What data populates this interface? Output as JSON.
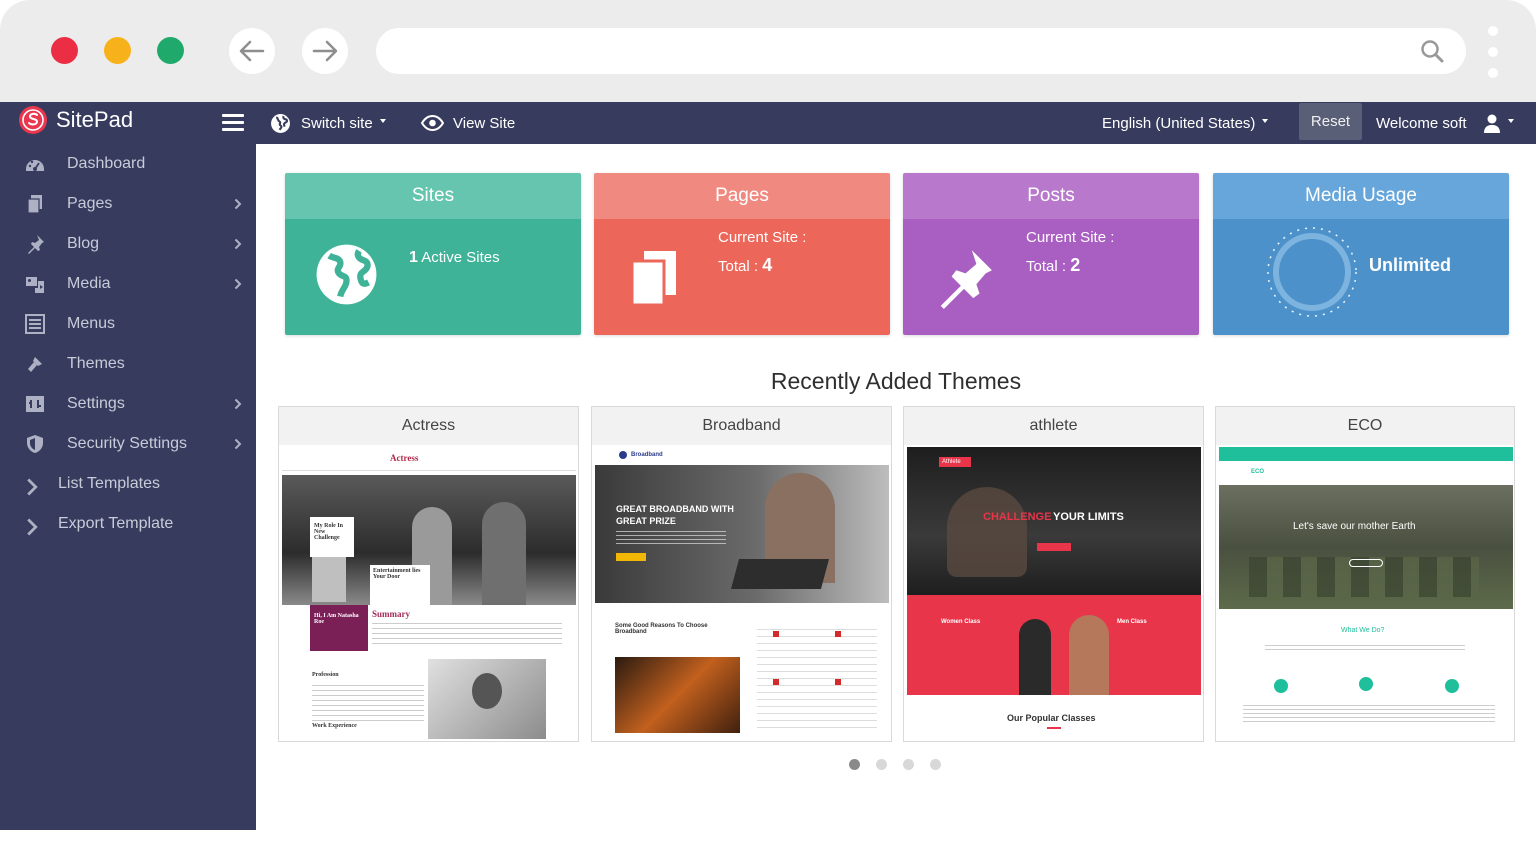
{
  "brand": {
    "name": "SitePad"
  },
  "topbar": {
    "switch_site": "Switch site",
    "view_site": "View Site",
    "language": "English (United States)",
    "reset": "Reset",
    "welcome": "Welcome soft"
  },
  "sidebar": {
    "items": [
      {
        "label": "Dashboard",
        "icon": "dashboard-icon",
        "has_children": false
      },
      {
        "label": "Pages",
        "icon": "pages-icon",
        "has_children": true
      },
      {
        "label": "Blog",
        "icon": "pin-icon",
        "has_children": true
      },
      {
        "label": "Media",
        "icon": "media-icon",
        "has_children": true
      },
      {
        "label": "Menus",
        "icon": "menu-list-icon",
        "has_children": false
      },
      {
        "label": "Themes",
        "icon": "brush-icon",
        "has_children": false
      },
      {
        "label": "Settings",
        "icon": "settings-icon",
        "has_children": true
      },
      {
        "label": "Security Settings",
        "icon": "shield-icon",
        "has_children": true
      },
      {
        "label": "List Templates",
        "icon": "chevron-right-icon",
        "has_children": false
      },
      {
        "label": "Export Template",
        "icon": "chevron-right-icon",
        "has_children": false
      }
    ]
  },
  "cards": {
    "sites": {
      "title": "Sites",
      "count": "1",
      "text": "Active Sites"
    },
    "pages": {
      "title": "Pages",
      "current_label": "Current Site :",
      "total_label": "Total :",
      "total": "4"
    },
    "posts": {
      "title": "Posts",
      "current_label": "Current Site :",
      "total_label": "Total :",
      "total": "2"
    },
    "media": {
      "title": "Media Usage",
      "text": "Unlimited"
    }
  },
  "themes_section": {
    "title": "Recently Added Themes",
    "themes": [
      {
        "name": "Actress"
      },
      {
        "name": "Broadband"
      },
      {
        "name": "athlete"
      },
      {
        "name": "ECO"
      }
    ]
  },
  "previews": {
    "actress": {
      "logo": "Actress",
      "hero_text": "My Role In New Challenge",
      "side_text": "Entertainment lies Your Door",
      "intro": "Hi, I Am Natasha Roe",
      "summary": "Summary",
      "profession": "Profession",
      "experience": "Work Experience"
    },
    "broadband": {
      "logo": "Broadband",
      "hero_title": "GREAT BROADBAND WITH GREAT PRIZE",
      "sub": "Some Good Reasons To Choose Broadband"
    },
    "athlete": {
      "logo": "Athlete",
      "challenge": "CHALLENGE",
      "limits": "YOUR LIMITS",
      "women": "Women Class",
      "men": "Men Class",
      "popular": "Our Popular Classes"
    },
    "eco": {
      "logo": "ECO",
      "hero": "Let's save our mother Earth",
      "what": "What We Do?"
    }
  },
  "colors": {
    "sidebar_bg": "#373c5e",
    "sites": "#3fb398",
    "pages": "#ec665a",
    "posts": "#a95ec1",
    "media": "#4c91ca"
  }
}
